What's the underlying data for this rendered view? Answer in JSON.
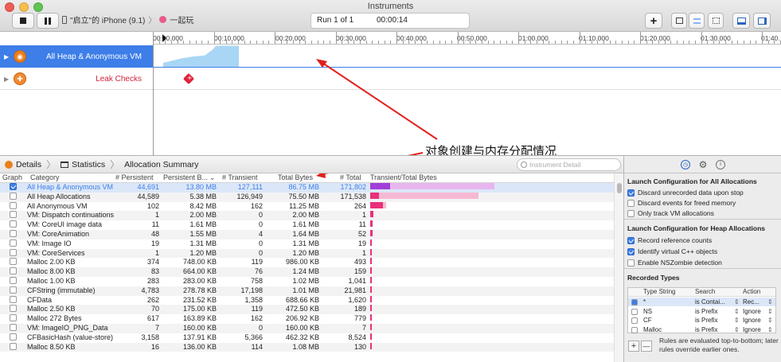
{
  "window": {
    "title": "Instruments"
  },
  "toolbar": {
    "record_icon": "stop-icon",
    "pause_icon": "pause-icon",
    "target_device": "\"启立\"的 iPhone (9.1)",
    "target_app": "一起玩",
    "run_label": "Run 1 of 1",
    "elapsed_time": "00:00:14",
    "add_label": "+"
  },
  "timeline": {
    "ticks": [
      "00:00.000",
      "00:10.000",
      "00:20.000",
      "00:30.000",
      "00:40.000",
      "00:50.000",
      "01:00.000",
      "01:10.000",
      "01:20.000",
      "01:30.000",
      "01:40."
    ],
    "tracks": [
      {
        "label": "All Heap & Anonymous VM",
        "selected": true
      },
      {
        "label": "Leak Checks",
        "selected": false
      }
    ]
  },
  "annotation": {
    "text": "对象创建与内存分配情况"
  },
  "jumpbar": {
    "details_label": "Details",
    "statistics_label": "Statistics",
    "summary_label": "Allocation Summary",
    "search_placeholder": "Instrument Detail"
  },
  "table": {
    "headers": {
      "graph": "Graph",
      "category": "Category",
      "persistent": "# Persistent",
      "persistent_bytes": "Persistent B...",
      "transient": "# Transient",
      "total_bytes": "Total Bytes",
      "total": "# Total",
      "transient_total": "Transient/Total Bytes"
    },
    "rows": [
      {
        "checked": true,
        "category": "All Heap & Anonymous VM",
        "persistent": "44,691",
        "persistent_bytes": "13.80 MB",
        "transient": "127,111",
        "total_bytes": "86.75 MB",
        "total": "171,802",
        "bar_total": 1.0,
        "bar_persist": 0.16
      },
      {
        "checked": false,
        "category": "All Heap Allocations",
        "persistent": "44,589",
        "persistent_bytes": "5.38 MB",
        "transient": "126,949",
        "total_bytes": "75.50 MB",
        "total": "171,538",
        "bar_total": 0.87,
        "bar_persist": 0.07
      },
      {
        "checked": false,
        "category": "All Anonymous VM",
        "persistent": "102",
        "persistent_bytes": "8.42 MB",
        "transient": "162",
        "total_bytes": "11.25 MB",
        "total": "264",
        "bar_total": 0.13,
        "bar_persist": 0.1
      },
      {
        "checked": false,
        "category": "VM: Dispatch continuations",
        "persistent": "1",
        "persistent_bytes": "2.00 MB",
        "transient": "0",
        "total_bytes": "2.00 MB",
        "total": "1",
        "bar_total": 0.023,
        "bar_persist": 0.023
      },
      {
        "checked": false,
        "category": "VM: CoreUI image data",
        "persistent": "11",
        "persistent_bytes": "1.61 MB",
        "transient": "0",
        "total_bytes": "1.61 MB",
        "total": "11",
        "bar_total": 0.019,
        "bar_persist": 0.019
      },
      {
        "checked": false,
        "category": "VM: CoreAnimation",
        "persistent": "48",
        "persistent_bytes": "1.55 MB",
        "transient": "4",
        "total_bytes": "1.64 MB",
        "total": "52",
        "bar_total": 0.019,
        "bar_persist": 0.018
      },
      {
        "checked": false,
        "category": "VM: Image IO",
        "persistent": "19",
        "persistent_bytes": "1.31 MB",
        "transient": "0",
        "total_bytes": "1.31 MB",
        "total": "19",
        "bar_total": 0.015,
        "bar_persist": 0.015
      },
      {
        "checked": false,
        "category": "VM: CoreServices",
        "persistent": "1",
        "persistent_bytes": "1.20 MB",
        "transient": "0",
        "total_bytes": "1.20 MB",
        "total": "1",
        "bar_total": 0.014,
        "bar_persist": 0.014
      },
      {
        "checked": false,
        "category": "Malloc 2.00 KB",
        "persistent": "374",
        "persistent_bytes": "748.00 KB",
        "transient": "119",
        "total_bytes": "986.00 KB",
        "total": "493",
        "bar_total": 0.011,
        "bar_persist": 0.009
      },
      {
        "checked": false,
        "category": "Malloc 8.00 KB",
        "persistent": "83",
        "persistent_bytes": "664.00 KB",
        "transient": "76",
        "total_bytes": "1.24 MB",
        "total": "159",
        "bar_total": 0.014,
        "bar_persist": 0.008
      },
      {
        "checked": false,
        "category": "Malloc 1.00 KB",
        "persistent": "283",
        "persistent_bytes": "283.00 KB",
        "transient": "758",
        "total_bytes": "1.02 MB",
        "total": "1,041",
        "bar_total": 0.012,
        "bar_persist": 0.003
      },
      {
        "checked": false,
        "category": "CFString (immutable)",
        "persistent": "4,783",
        "persistent_bytes": "278.78 KB",
        "transient": "17,198",
        "total_bytes": "1.01 MB",
        "total": "21,981",
        "bar_total": 0.012,
        "bar_persist": 0.003
      },
      {
        "checked": false,
        "category": "CFData",
        "persistent": "262",
        "persistent_bytes": "231.52 KB",
        "transient": "1,358",
        "total_bytes": "688.66 KB",
        "total": "1,620",
        "bar_total": 0.008,
        "bar_persist": 0.003
      },
      {
        "checked": false,
        "category": "Malloc 2.50 KB",
        "persistent": "70",
        "persistent_bytes": "175.00 KB",
        "transient": "119",
        "total_bytes": "472.50 KB",
        "total": "189",
        "bar_total": 0.005,
        "bar_persist": 0.002
      },
      {
        "checked": false,
        "category": "Malloc 272 Bytes",
        "persistent": "617",
        "persistent_bytes": "163.89 KB",
        "transient": "162",
        "total_bytes": "206.92 KB",
        "total": "779",
        "bar_total": 0.003,
        "bar_persist": 0.002
      },
      {
        "checked": false,
        "category": "VM: ImageIO_PNG_Data",
        "persistent": "7",
        "persistent_bytes": "160.00 KB",
        "transient": "0",
        "total_bytes": "160.00 KB",
        "total": "7",
        "bar_total": 0.002,
        "bar_persist": 0.002
      },
      {
        "checked": false,
        "category": "CFBasicHash (value-store)",
        "persistent": "3,158",
        "persistent_bytes": "137.91 KB",
        "transient": "5,366",
        "total_bytes": "462.32 KB",
        "total": "8,524",
        "bar_total": 0.005,
        "bar_persist": 0.002
      },
      {
        "checked": false,
        "category": "Malloc 8.50 KB",
        "persistent": "16",
        "persistent_bytes": "136.00 KB",
        "transient": "114",
        "total_bytes": "1.08 MB",
        "total": "130",
        "bar_total": 0.012,
        "bar_persist": 0.002
      }
    ]
  },
  "inspector": {
    "tab_icons": [
      "record-settings-icon",
      "gear-icon",
      "info-icon"
    ],
    "all_alloc": {
      "title": "Launch Configuration for All Allocations",
      "options": [
        {
          "label": "Discard unrecorded data upon stop",
          "checked": true
        },
        {
          "label": "Discard events for freed memory",
          "checked": false
        },
        {
          "label": "Only track VM allocations",
          "checked": false
        }
      ]
    },
    "heap_alloc": {
      "title": "Launch Configuration for Heap Allocations",
      "options": [
        {
          "label": "Record reference counts",
          "checked": true
        },
        {
          "label": "Identify virtual C++ objects",
          "checked": true
        },
        {
          "label": "Enable NSZombie detection",
          "checked": false
        }
      ]
    },
    "recorded": {
      "title": "Recorded Types",
      "headers": {
        "type": "Type String",
        "search": "Search",
        "action": "Action"
      },
      "rows": [
        {
          "checked": true,
          "type": "*",
          "search": "is Contai...",
          "action": "Rec..."
        },
        {
          "checked": false,
          "type": "NS",
          "search": "is Prefix",
          "action": "Ignore"
        },
        {
          "checked": false,
          "type": "CF",
          "search": "is Prefix",
          "action": "Ignore"
        },
        {
          "checked": false,
          "type": "Malloc",
          "search": "is Prefix",
          "action": "Ignore"
        }
      ]
    },
    "add_label": "+",
    "remove_label": "—",
    "rules_note": "Rules are evaluated top-to-bottom; later rules override earlier ones."
  },
  "colors": {
    "accent": "#3d7ee8",
    "bar_persist": "#a23ed8",
    "bar_transient": "#e8b6ef",
    "heap_graph": "#a9d6f5",
    "annotation_arrow": "#e0201c"
  }
}
